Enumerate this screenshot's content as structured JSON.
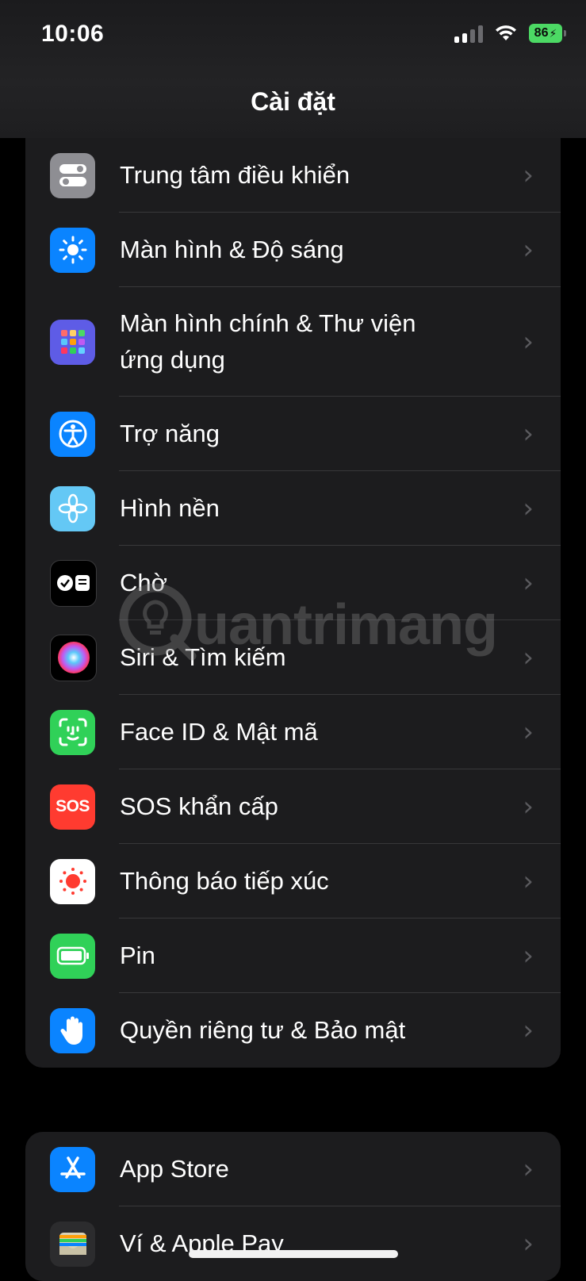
{
  "status_bar": {
    "time": "10:06",
    "battery": "86"
  },
  "header": {
    "title": "Cài đặt"
  },
  "group1": [
    {
      "label": "Trung tâm điều khiển",
      "icon": "control-center-icon"
    },
    {
      "label": "Màn hình & Độ sáng",
      "icon": "brightness-icon"
    },
    {
      "label": "Màn hình chính & Thư viện ứng dụng",
      "icon": "home-screen-icon"
    },
    {
      "label": "Trợ năng",
      "icon": "accessibility-icon"
    },
    {
      "label": "Hình nền",
      "icon": "wallpaper-icon"
    },
    {
      "label": "Chờ",
      "icon": "standby-icon"
    },
    {
      "label": "Siri & Tìm kiếm",
      "icon": "siri-icon"
    },
    {
      "label": "Face ID & Mật mã",
      "icon": "face-id-icon"
    },
    {
      "label": "SOS khẩn cấp",
      "icon": "sos-icon",
      "icon_text": "SOS"
    },
    {
      "label": "Thông báo tiếp xúc",
      "icon": "exposure-notification-icon"
    },
    {
      "label": "Pin",
      "icon": "battery-icon"
    },
    {
      "label": "Quyền riêng tư & Bảo mật",
      "icon": "privacy-hand-icon"
    }
  ],
  "group2": [
    {
      "label": "App Store",
      "icon": "app-store-icon"
    },
    {
      "label": "Ví & Apple Pay",
      "icon": "wallet-icon"
    }
  ],
  "watermark": {
    "text": "uantrimang"
  },
  "colors": {
    "background": "#000000",
    "cell": "#1c1c1e",
    "separator": "#38383a",
    "chevron": "#5a5a5e",
    "battery": "#4cd964"
  }
}
